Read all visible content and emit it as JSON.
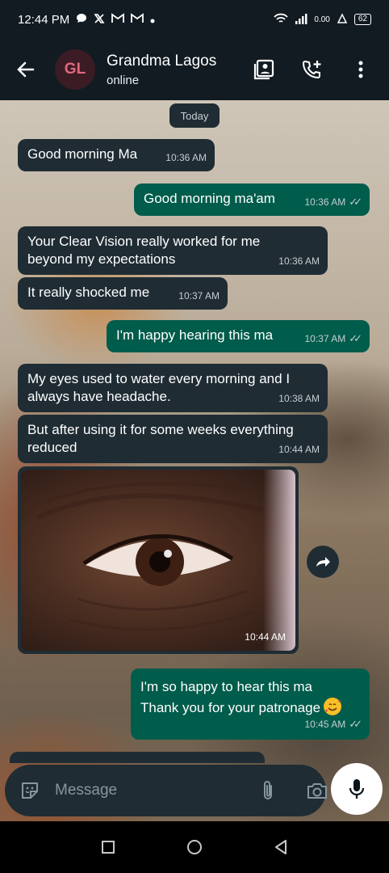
{
  "status_bar": {
    "time": "12:44 PM",
    "network_speed": "0.00",
    "battery": "62",
    "notification_icons": [
      "chat-bubble-icon",
      "x-icon",
      "gmail-icon",
      "gmail-icon",
      "dot-icon"
    ]
  },
  "header": {
    "avatar_initials": "GL",
    "contact_name": "Grandma Lagos",
    "contact_status": "online"
  },
  "chat": {
    "date_chip": "Today",
    "messages": [
      {
        "dir": "in",
        "text": "Good morning Ma",
        "time": "10:36 AM"
      },
      {
        "dir": "out",
        "text": "Good morning ma'am",
        "time": "10:36 AM"
      },
      {
        "dir": "in",
        "lines": [
          "Your Clear Vision really worked for me",
          "beyond my expectations"
        ],
        "time": "10:36 AM"
      },
      {
        "dir": "in",
        "text": "It really shocked me",
        "time": "10:37 AM"
      },
      {
        "dir": "out",
        "text": "I'm happy hearing this ma",
        "time": "10:37 AM"
      },
      {
        "dir": "in",
        "lines": [
          "My eyes used to water every morning and I",
          "always have headache."
        ],
        "time": "10:38 AM"
      },
      {
        "dir": "in",
        "lines": [
          "But after using it for some weeks everything",
          "reduced"
        ],
        "time": "10:44 AM"
      },
      {
        "dir": "in",
        "type": "image",
        "time": "10:44 AM"
      },
      {
        "dir": "out",
        "lines": [
          "I'm so happy to hear this ma",
          "Thank you for your patronage"
        ],
        "time": "10:45 AM"
      }
    ]
  },
  "composer": {
    "placeholder": "Message"
  },
  "colors": {
    "incoming_bubble": "#1f2c34",
    "outgoing_bubble": "#005c4b",
    "header_bg": "#121b22",
    "avatar_text": "#e06a7c"
  }
}
